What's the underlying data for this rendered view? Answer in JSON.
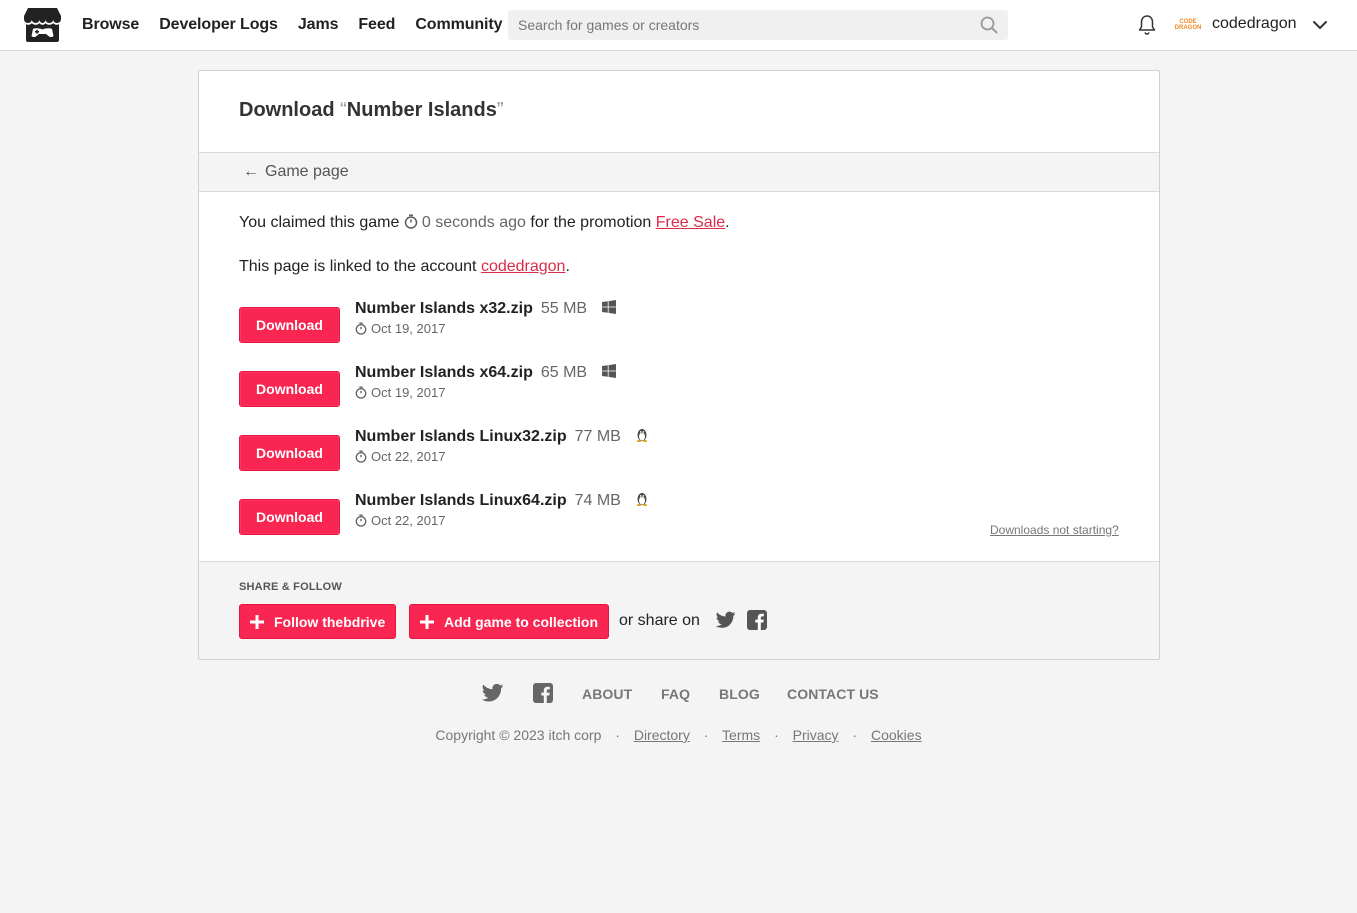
{
  "header": {
    "nav": [
      "Browse",
      "Developer Logs",
      "Jams",
      "Feed",
      "Community"
    ],
    "search_placeholder": "Search for games or creators",
    "avatar_text_1": "CODE",
    "avatar_text_2": "DRAGON",
    "username": "codedragon"
  },
  "download_page": {
    "title_prefix": "Download",
    "title_open_quote": "“",
    "title_game": "Number Islands",
    "title_close_quote": "”",
    "back_link": "Game page",
    "claim_text_1": "You claimed this game",
    "claim_time": "0 seconds ago",
    "claim_text_2": "for the promotion",
    "promotion": "Free Sale",
    "linked_text": "This page is linked to the account",
    "linked_account": "codedragon",
    "download_label": "Download",
    "files": [
      {
        "name": "Number Islands x32.zip",
        "size": "55 MB",
        "platform": "windows-icon",
        "date": "Oct 19, 2017"
      },
      {
        "name": "Number Islands x64.zip",
        "size": "65 MB",
        "platform": "windows-icon",
        "date": "Oct 19, 2017"
      },
      {
        "name": "Number Islands Linux32.zip",
        "size": "77 MB",
        "platform": "linux-icon",
        "date": "Oct 22, 2017"
      },
      {
        "name": "Number Islands Linux64.zip",
        "size": "74 MB",
        "platform": "linux-icon",
        "date": "Oct 22, 2017"
      }
    ],
    "not_starting": "Downloads not starting?"
  },
  "share": {
    "title": "SHARE & FOLLOW",
    "follow_label": "Follow thebdrive",
    "collection_label": "Add game to collection",
    "or_share": "or share on"
  },
  "footer": {
    "links": [
      "ABOUT",
      "FAQ",
      "BLOG",
      "CONTACT US"
    ],
    "copyright": "Copyright © 2023 itch corp",
    "legal": [
      "Directory",
      "Terms",
      "Privacy",
      "Cookies"
    ]
  },
  "colors": {
    "accent": "#fa2652",
    "link": "#da2c49",
    "background": "#f4f4f4"
  }
}
